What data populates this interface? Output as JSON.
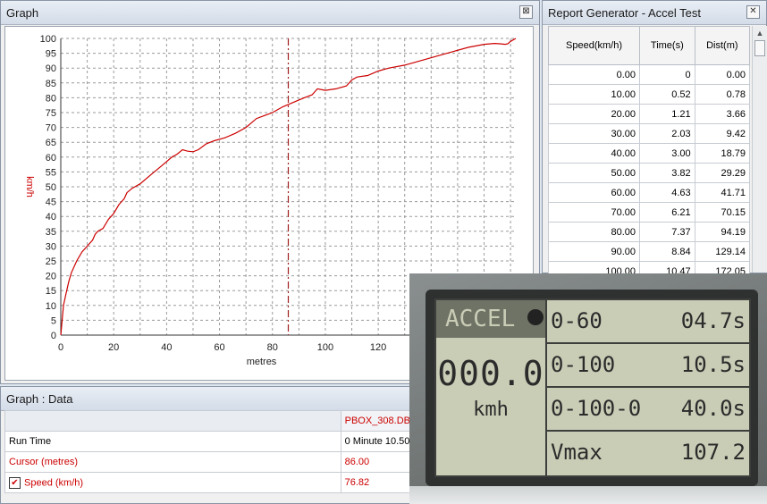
{
  "graph_panel": {
    "title": "Graph",
    "close": "⊠"
  },
  "report_panel": {
    "title": "Report Generator - Accel Test",
    "close": "✕",
    "columns": [
      "Speed(km/h)",
      "Time(s)",
      "Dist(m)"
    ],
    "rows": [
      [
        "0.00",
        "0",
        "0.00"
      ],
      [
        "10.00",
        "0.52",
        "0.78"
      ],
      [
        "20.00",
        "1.21",
        "3.66"
      ],
      [
        "30.00",
        "2.03",
        "9.42"
      ],
      [
        "40.00",
        "3.00",
        "18.79"
      ],
      [
        "50.00",
        "3.82",
        "29.29"
      ],
      [
        "60.00",
        "4.63",
        "41.71"
      ],
      [
        "70.00",
        "6.21",
        "70.15"
      ],
      [
        "80.00",
        "7.37",
        "94.19"
      ],
      [
        "90.00",
        "8.84",
        "129.14"
      ],
      [
        "100.00",
        "10.47",
        "172.05"
      ]
    ]
  },
  "data_panel": {
    "title": "Graph : Data",
    "file_header": "PBOX_308.DB",
    "rows": [
      {
        "label": "Run Time",
        "value": "0 Minute 10.50"
      },
      {
        "label": "Cursor (metres)",
        "value": "86.00"
      },
      {
        "label": "Speed (km/h)",
        "value": "76.82",
        "checked": true
      }
    ]
  },
  "device": {
    "mode": "ACCEL",
    "speed": "000.0",
    "unit": "kmh",
    "rows": [
      {
        "k": "0-60",
        "v": "04.7s"
      },
      {
        "k": "0-100",
        "v": "10.5s"
      },
      {
        "k": "0-100-0",
        "v": "40.0s"
      },
      {
        "k": "Vmax",
        "v": "107.2"
      }
    ]
  },
  "chart_data": {
    "type": "line",
    "xlabel": "metres",
    "ylabel": "km/h",
    "xlim": [
      0,
      172
    ],
    "ylim": [
      0,
      100
    ],
    "xticks": [
      0,
      20,
      40,
      60,
      80,
      100,
      120
    ],
    "yticks": [
      0,
      5,
      10,
      15,
      20,
      25,
      30,
      35,
      40,
      45,
      50,
      55,
      60,
      65,
      70,
      75,
      80,
      85,
      90,
      95,
      100
    ],
    "grid": true,
    "line_color": "#cc0000",
    "cursor_x": 86,
    "series": [
      {
        "x": [
          0,
          0.5,
          1,
          2,
          3,
          4,
          6,
          8,
          10,
          12,
          13,
          14,
          16,
          18,
          20,
          22,
          24,
          25,
          27,
          30,
          34,
          38,
          42,
          44,
          46,
          48,
          50,
          52,
          55,
          58,
          62,
          66,
          70,
          74,
          77,
          80,
          84,
          88,
          92,
          95,
          97,
          100,
          104,
          108,
          110,
          112,
          116,
          120,
          124,
          130,
          136,
          142,
          148,
          154,
          160,
          164,
          166,
          168,
          169,
          170,
          172
        ],
        "y": [
          0,
          5,
          10,
          14,
          18,
          21,
          25,
          28,
          30,
          32,
          34,
          35,
          36,
          39,
          41,
          44,
          46,
          48,
          49.5,
          51,
          54,
          57,
          60,
          61,
          62.5,
          62,
          61.8,
          62.5,
          64.5,
          65.5,
          66.5,
          68,
          70,
          73,
          74,
          75,
          77,
          78.5,
          80,
          81,
          83,
          82.5,
          83,
          84,
          86,
          87,
          87.5,
          89,
          90,
          91,
          92.5,
          94,
          95.5,
          97,
          98,
          98.3,
          98.2,
          98,
          98.2,
          99,
          100
        ]
      }
    ]
  }
}
